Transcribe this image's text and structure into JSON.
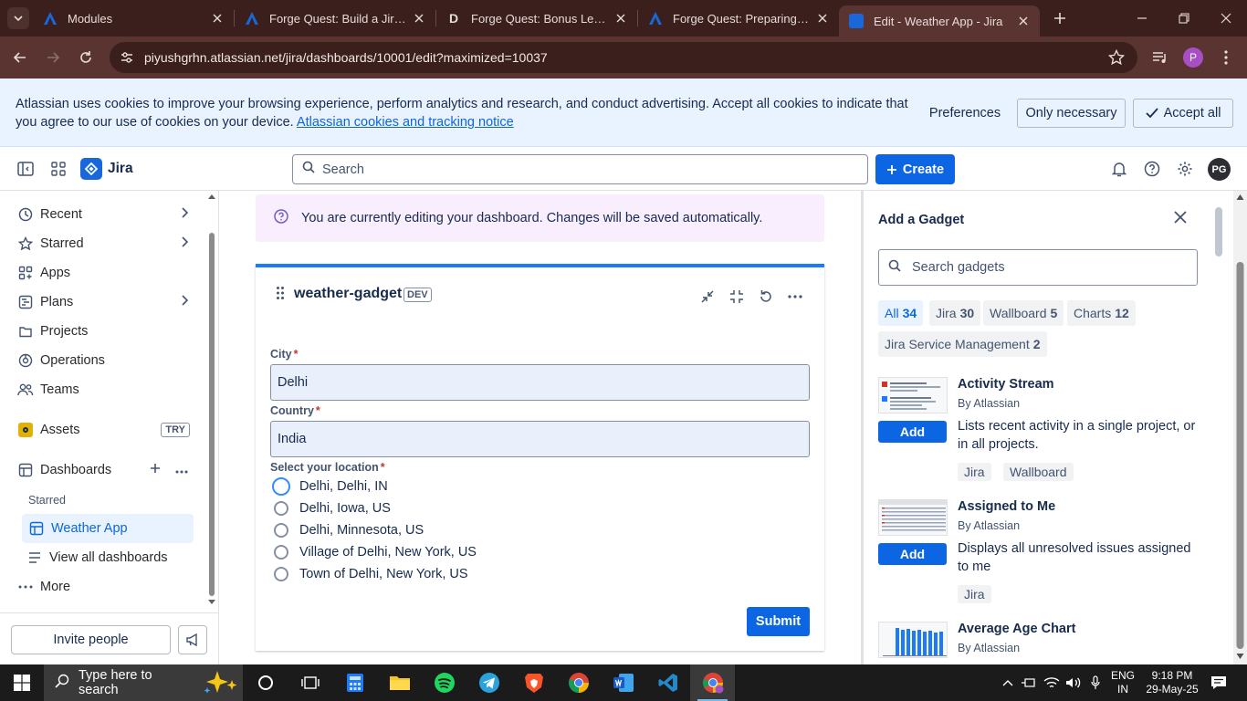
{
  "browser": {
    "tabs": [
      {
        "title": "Modules",
        "favicon": "atlassian-icon"
      },
      {
        "title": "Forge Quest: Build a Jira Das",
        "favicon": "atlassian-icon"
      },
      {
        "title": "Forge Quest: Bonus Level: Sh",
        "favicon": "d-icon"
      },
      {
        "title": "Forge Quest: Preparing your",
        "favicon": "atlassian-icon"
      },
      {
        "title": "Edit - Weather App - Jira",
        "favicon": "jira-icon"
      }
    ],
    "url": "piyushgrhn.atlassian.net/jira/dashboards/10001/edit?maximized=10037",
    "profile_initial": "P"
  },
  "cookie_banner": {
    "message": "Atlassian uses cookies to improve your browsing experience, perform analytics and research, and conduct advertising. Accept all cookies to indicate that you agree to our use of cookies on your device.",
    "link": "Atlassian cookies and tracking notice",
    "preferences": "Preferences",
    "only_necessary": "Only necessary",
    "accept_all": "Accept all"
  },
  "topnav": {
    "product": "Jira",
    "search_placeholder": "Search",
    "create": "Create",
    "avatar": "PG"
  },
  "sidebar": {
    "items": [
      {
        "label": "Recent",
        "icon": "clock-icon"
      },
      {
        "label": "Starred",
        "icon": "star-icon"
      },
      {
        "label": "Apps",
        "icon": "apps-icon"
      },
      {
        "label": "Plans",
        "icon": "plans-icon"
      },
      {
        "label": "Projects",
        "icon": "projects-icon"
      },
      {
        "label": "Operations",
        "icon": "operations-icon"
      },
      {
        "label": "Teams",
        "icon": "teams-icon"
      }
    ],
    "assets": "Assets",
    "try": "TRY",
    "dashboards": "Dashboards",
    "starred_label": "Starred",
    "weather_app": "Weather App",
    "view_all": "View all dashboards",
    "more": "More",
    "invite": "Invite people"
  },
  "main": {
    "banner": "You are currently editing your dashboard. Changes will be saved automatically.",
    "gadget": {
      "title": "weather-gadget",
      "env": "DEV",
      "city_label": "City",
      "city_value": "Delhi",
      "country_label": "Country",
      "country_value": "India",
      "location_label": "Select your location",
      "options": [
        "Delhi, Delhi, IN",
        "Delhi, Iowa, US",
        "Delhi, Minnesota, US",
        "Village of Delhi, New York, US",
        "Town of Delhi, New York, US"
      ],
      "selected_option": "Delhi, Delhi, IN",
      "submit": "Submit"
    }
  },
  "panel": {
    "title": "Add a Gadget",
    "search_placeholder": "Search gadgets",
    "filters": [
      {
        "label": "All",
        "count": "34"
      },
      {
        "label": "Jira",
        "count": "30"
      },
      {
        "label": "Wallboard",
        "count": "5"
      },
      {
        "label": "Charts",
        "count": "12"
      },
      {
        "label": "Jira Service Management",
        "count": "2"
      }
    ],
    "gadgets": [
      {
        "name": "Activity Stream",
        "by": "By Atlassian",
        "desc": "Lists recent activity in a single project, or in all projects.",
        "tags": [
          "Jira",
          "Wallboard"
        ],
        "add": "Add"
      },
      {
        "name": "Assigned to Me",
        "by": "By Atlassian",
        "desc": "Displays all unresolved issues assigned to me",
        "tags": [
          "Jira"
        ],
        "add": "Add"
      },
      {
        "name": "Average Age Chart",
        "by": "By Atlassian"
      }
    ]
  },
  "taskbar": {
    "search_placeholder": "Type here to search",
    "lang": "ENG",
    "region": "IN",
    "time": "9:18 PM",
    "date": "29-May-25"
  },
  "colors": {
    "jira_blue": "#0c66e4",
    "browser_frame": "#3a1f1d",
    "cookie_bg": "#e9f2ff",
    "edit_banner_bg": "#f8eefe"
  }
}
